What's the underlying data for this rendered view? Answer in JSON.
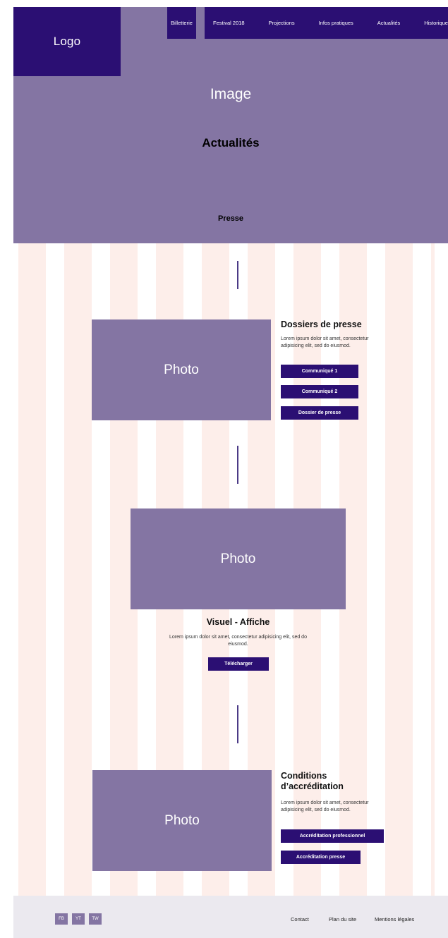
{
  "header": {
    "logo": "Logo",
    "nav": [
      "Billetterie",
      "Festival 2018",
      "Projections",
      "Infos pratiques",
      "Actualités",
      "Historique"
    ]
  },
  "hero": {
    "image_label": "Image",
    "title": "Actualités",
    "subtitle": "Presse"
  },
  "sections": {
    "dossiers": {
      "photo_label": "Photo",
      "title": "Dossiers de presse",
      "text": "Lorem ipsum dolor sit amet, consectetur adipisicing elit, sed do eiusmod.",
      "buttons": [
        "Communiqué 1",
        "Communiqué 2",
        "Dossier de presse"
      ]
    },
    "visuel": {
      "photo_label": "Photo",
      "title": "Visuel - Affiche",
      "text": "Lorem ipsum dolor sit amet, consectetur adipisicing elit, sed do eiusmod.",
      "button": "Télécharger"
    },
    "conditions": {
      "photo_label": "Photo",
      "title": "Conditions d’accréditation",
      "text": "Lorem ipsum dolor sit amet, consectetur adipisicing elit, sed do eiusmod.",
      "buttons": [
        "Accréditation professionnel",
        "Accréditation presse"
      ]
    }
  },
  "footer": {
    "social": [
      "FB",
      "YT",
      "TW"
    ],
    "links": [
      "Contact",
      "Plan du site",
      "Mentions légales"
    ]
  },
  "colors": {
    "primary": "#2b0f73",
    "secondary": "#8475a3",
    "grid_column": "#fdeeea",
    "footer_bg": "#ebe9ef"
  }
}
